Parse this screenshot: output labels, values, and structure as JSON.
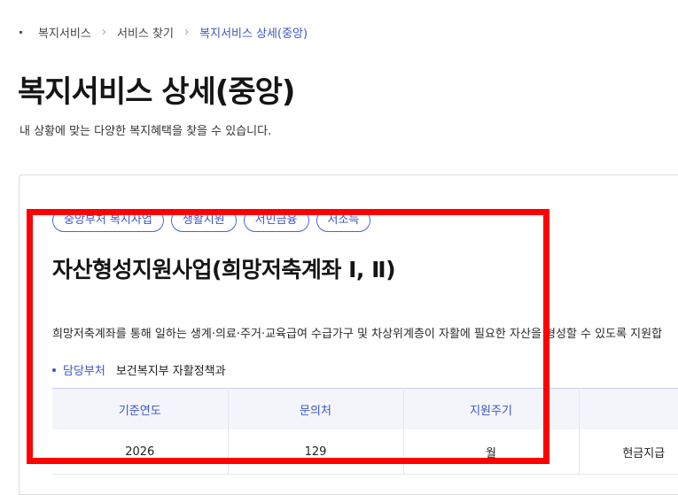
{
  "breadcrumb": [
    {
      "label": "복지서비스"
    },
    {
      "label": "서비스 찾기"
    },
    {
      "label": "복지서비스 상세(중앙)"
    }
  ],
  "page": {
    "title": "복지서비스 상세(중앙)",
    "description": "내 상황에 맞는 다양한 복지혜택을 찾을 수 있습니다."
  },
  "service": {
    "tags": [
      "중앙부처 복지사업",
      "생활지원",
      "서민금융",
      "저소득"
    ],
    "title": "자산형성지원사업(희망저축계좌 Ⅰ, Ⅱ)",
    "description": "희망저축계좌를 통해 일하는 생계·의료·주거·교육급여 수급가구 및 차상위계층이 자활에 필요한 자산을 형성할 수 있도록 지원합",
    "department": {
      "label": "담당부처",
      "value": "보건복지부 자활정책과"
    },
    "table": {
      "headers": [
        "기준연도",
        "문의처",
        "지원주기",
        ""
      ],
      "row": [
        "2026",
        "129",
        "월",
        "현금지급"
      ]
    }
  },
  "colors": {
    "accent": "#3d55c8",
    "highlight": "#ff0000"
  }
}
